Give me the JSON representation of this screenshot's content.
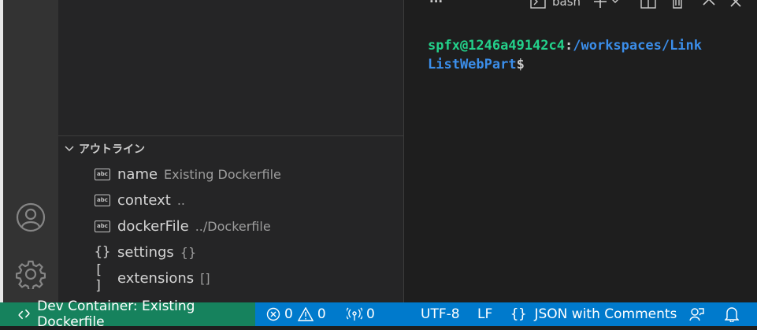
{
  "sidebar": {
    "outline_title": "アウトライン",
    "items": [
      {
        "icon": "string-icon",
        "label": "name",
        "detail": "Existing Dockerfile"
      },
      {
        "icon": "string-icon",
        "label": "context",
        "detail": ".."
      },
      {
        "icon": "string-icon",
        "label": "dockerFile",
        "detail": "../Dockerfile"
      },
      {
        "icon": "object-icon",
        "symbol": "{}",
        "label": "settings",
        "detail": "{}"
      },
      {
        "icon": "array-icon",
        "symbol": "[ ]",
        "label": "extensions",
        "detail": "[]"
      }
    ]
  },
  "terminal": {
    "toolbar": {
      "more": "···",
      "shell": "bash"
    },
    "prompt_user": "spfx@1246a49142c4",
    "prompt_colon": ":",
    "prompt_path_line1": "/workspaces/Link",
    "prompt_path_line2": "ListWebPart",
    "prompt_dollar": "$"
  },
  "statusbar": {
    "remote": "Dev Container: Existing Dockerfile",
    "errors": "0",
    "warnings": "0",
    "ports": "0",
    "encoding": "UTF-8",
    "eol": "LF",
    "language": "JSON with Comments",
    "colors": {
      "remote_bg": "#16825d",
      "bar_bg": "#007acc"
    }
  }
}
